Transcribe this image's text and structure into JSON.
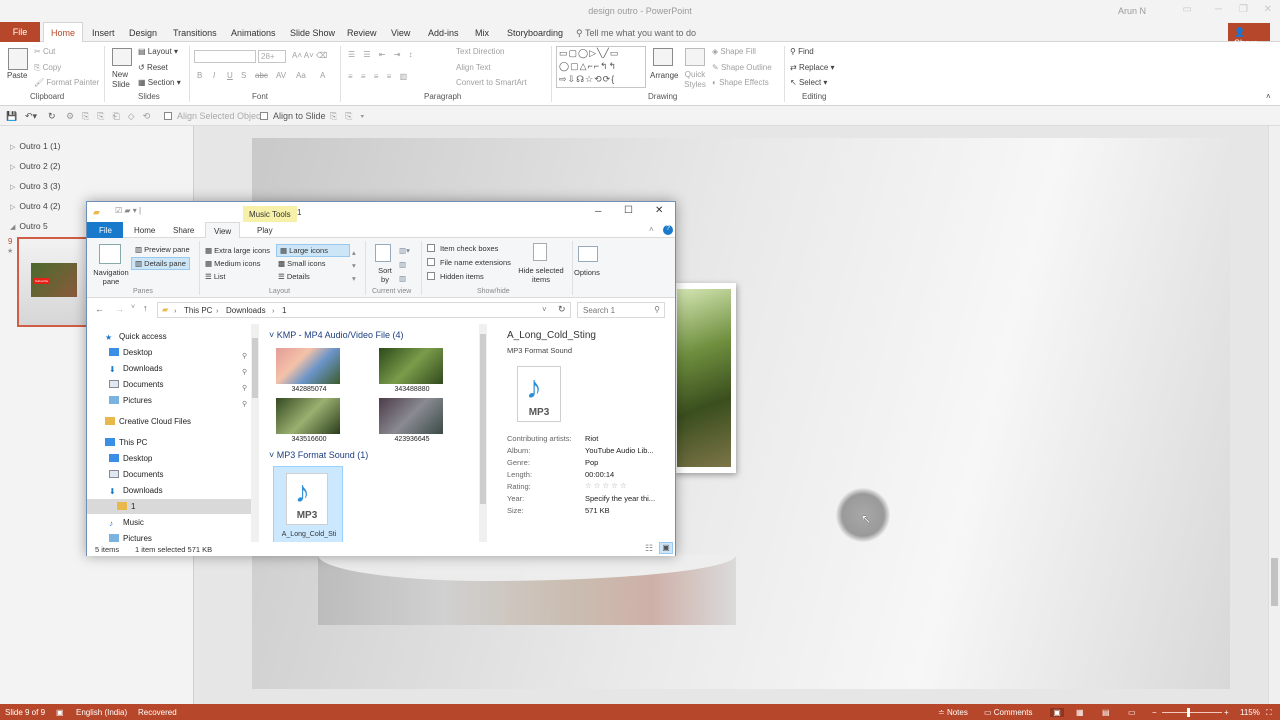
{
  "window": {
    "title": "design outro - PowerPoint",
    "user": "Arun N",
    "controls": [
      "─",
      "❐",
      "✕"
    ]
  },
  "ribbon_tabs": [
    "File",
    "Home",
    "Insert",
    "Design",
    "Transitions",
    "Animations",
    "Slide Show",
    "Review",
    "View",
    "Add-ins",
    "Mix",
    "Storyboarding"
  ],
  "active_tab": "Home",
  "tell_me": "Tell me what you want to do",
  "share": "Share",
  "ribbon": {
    "clipboard": {
      "paste": "Paste",
      "cut": "Cut",
      "copy": "Copy",
      "format_painter": "Format Painter",
      "label": "Clipboard"
    },
    "slides": {
      "new_slide": "New Slide",
      "layout": "Layout",
      "reset": "Reset",
      "section": "Section",
      "label": "Slides"
    },
    "font": {
      "label": "Font",
      "size": "28+",
      "buttons": [
        "B",
        "I",
        "U",
        "S",
        "abc",
        "AV",
        "Aa",
        "A"
      ]
    },
    "paragraph": {
      "text_direction": "Text Direction",
      "align_text": "Align Text",
      "convert_smartart": "Convert to SmartArt",
      "label": "Paragraph"
    },
    "drawing": {
      "arrange": "Arrange",
      "quick_styles": "Quick Styles",
      "shape_fill": "Shape Fill",
      "shape_outline": "Shape Outline",
      "shape_effects": "Shape Effects",
      "label": "Drawing"
    },
    "editing": {
      "find": "Find",
      "replace": "Replace",
      "select": "Select",
      "label": "Editing"
    }
  },
  "qat": {
    "align_selected": "Align Selected Objects",
    "align_to_slide": "Align to Slide"
  },
  "sections": [
    {
      "label": "Outro 1 (1)"
    },
    {
      "label": "Outro 2 (2)"
    },
    {
      "label": "Outro 3 (3)"
    },
    {
      "label": "Outro 4 (2)"
    },
    {
      "label": "Outro 5"
    }
  ],
  "thumbnail": {
    "number": "9",
    "star": "★",
    "subscribe": "Subscribe"
  },
  "status": {
    "slide": "Slide 9 of 9",
    "language": "English (India)",
    "recovered": "Recovered",
    "notes": "Notes",
    "comments": "Comments",
    "zoom": "115%"
  },
  "explorer": {
    "title": "1",
    "music_tools": "Music Tools",
    "tabs": {
      "file": "File",
      "home": "Home",
      "share": "Share",
      "view": "View",
      "play": "Play"
    },
    "panes": {
      "preview": "Preview pane",
      "details": "Details pane",
      "navigation": "Navigation pane",
      "label": "Panes"
    },
    "layout": {
      "xl_icons": "Extra large icons",
      "large_icons": "Large icons",
      "medium_icons": "Medium icons",
      "small_icons": "Small icons",
      "list": "List",
      "details": "Details",
      "label": "Layout"
    },
    "current_view": {
      "sort_by": "Sort by",
      "label": "Current view"
    },
    "show_hide": {
      "item_checkboxes": "Item check boxes",
      "file_ext": "File name extensions",
      "hidden_items": "Hidden items",
      "hide_selected": "Hide selected items",
      "label": "Show/hide"
    },
    "options": "Options",
    "address": {
      "this_pc": "This PC",
      "downloads": "Downloads",
      "folder": "1"
    },
    "search_placeholder": "Search 1",
    "nav": {
      "quick_access": "Quick access",
      "qa_items": [
        "Desktop",
        "Downloads",
        "Documents",
        "Pictures"
      ],
      "creative_cloud": "Creative Cloud Files",
      "this_pc": "This PC",
      "pc_items": [
        "Desktop",
        "Documents",
        "Downloads"
      ],
      "folder": "1",
      "music": "Music",
      "pictures": "Pictures"
    },
    "groups": {
      "video": {
        "header": "KMP - MP4 Audio/Video File (4)",
        "items": [
          "342885074",
          "343488880",
          "343516600",
          "423936645"
        ]
      },
      "audio": {
        "header": "MP3 Format Sound (1)",
        "item": "A_Long_Cold_Sti",
        "badge": "MP3"
      }
    },
    "details": {
      "name": "A_Long_Cold_Sting",
      "type": "MP3 Format Sound",
      "badge": "MP3",
      "props": [
        {
          "label": "Contributing artists:",
          "value": "Riot"
        },
        {
          "label": "Album:",
          "value": "YouTube Audio Lib..."
        },
        {
          "label": "Genre:",
          "value": "Pop"
        },
        {
          "label": "Length:",
          "value": "00:00:14"
        },
        {
          "label": "Rating:",
          "value": "☆☆☆☆☆"
        },
        {
          "label": "Year:",
          "value": "Specify the year thi..."
        },
        {
          "label": "Size:",
          "value": "571 KB"
        }
      ]
    },
    "status": {
      "items": "5 items",
      "selected": "1 item selected  571 KB"
    }
  }
}
